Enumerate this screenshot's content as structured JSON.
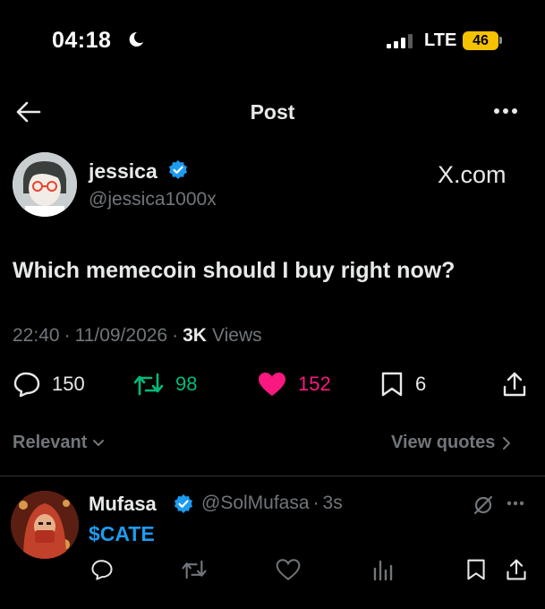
{
  "status_bar": {
    "time": "04:18",
    "network": "LTE",
    "battery": "46",
    "icons": [
      "moon-icon",
      "signal-icon",
      "battery-icon"
    ]
  },
  "header": {
    "title": "Post",
    "back_icon": "arrow-left-icon",
    "more_icon": "more-horizontal-icon"
  },
  "post": {
    "author_name": "jessica",
    "author_handle": "@jessica1000x",
    "source": "X.com",
    "text": "Which memecoin should I buy right now?",
    "time": "22:40",
    "date": "11/09/2026",
    "views_count": "3K",
    "views_label": "Views",
    "separator": "·",
    "actions": {
      "replies": "150",
      "reposts": "98",
      "likes": "152",
      "bookmarks": "6"
    }
  },
  "filter": {
    "relevant_label": "Relevant",
    "view_quotes_label": "View quotes"
  },
  "reply": {
    "name": "Mufasa",
    "handle": "@SolMufasa",
    "separator": "·",
    "age": "3s",
    "text": "$CATE"
  },
  "colors": {
    "background": "#000000",
    "text": "#e7e9ea",
    "muted": "#71767b",
    "verified": "#1d9bf0",
    "repost_green": "#00ba7c",
    "like_pink": "#f91880",
    "cashtag_blue": "#1d9bf0",
    "battery_yellow": "#f5c200"
  }
}
